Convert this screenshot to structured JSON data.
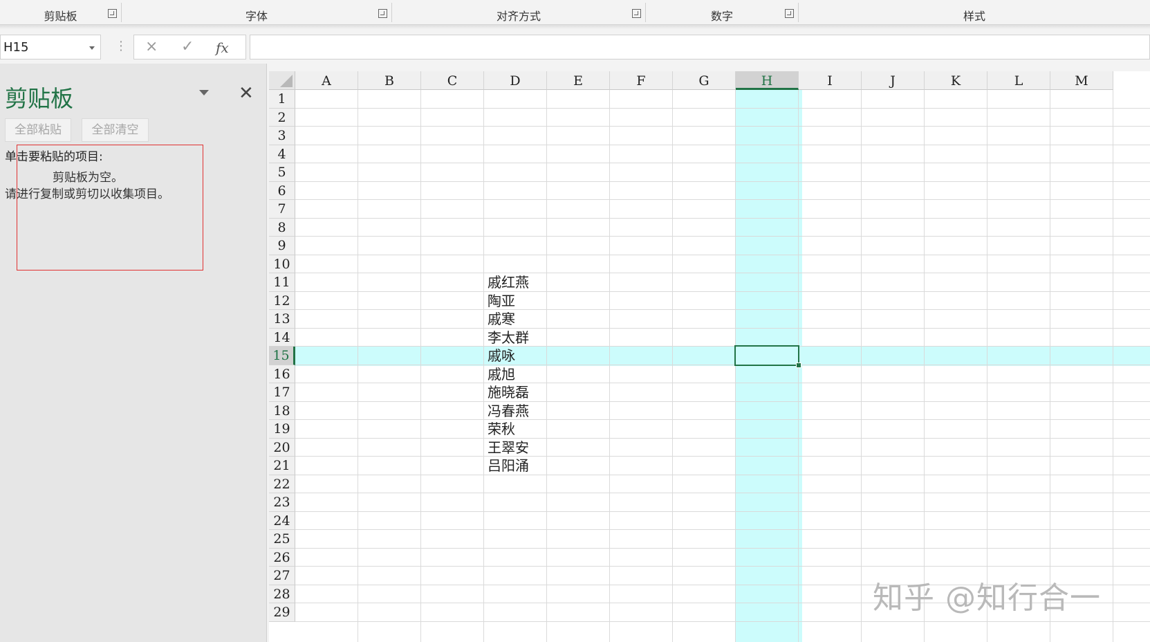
{
  "ribbon": {
    "groups": [
      {
        "label": "剪贴板",
        "launcher": true
      },
      {
        "label": "字体",
        "launcher": true
      },
      {
        "label": "对齐方式",
        "launcher": true
      },
      {
        "label": "数字",
        "launcher": true
      },
      {
        "label": "样式",
        "launcher": false
      }
    ]
  },
  "formula_bar": {
    "name_box": "H15",
    "cancel_icon": "×",
    "enter_icon": "✓",
    "fx_label": "fx",
    "formula": ""
  },
  "clipboard_pane": {
    "title": "剪贴板",
    "paste_all": "全部粘贴",
    "clear_all": "全部清空",
    "instruction": "单击要粘贴的项目:",
    "empty_line1": "剪贴板为空。",
    "empty_line2": "请进行复制或剪切以收集项目。"
  },
  "sheet": {
    "columns": [
      "A",
      "B",
      "C",
      "D",
      "E",
      "F",
      "G",
      "H",
      "I",
      "J",
      "K",
      "L",
      "M"
    ],
    "rows": [
      "1",
      "2",
      "3",
      "4",
      "5",
      "6",
      "7",
      "8",
      "9",
      "10",
      "11",
      "12",
      "13",
      "14",
      "15",
      "16",
      "17",
      "18",
      "19",
      "20",
      "21",
      "22",
      "23",
      "24",
      "25",
      "26",
      "27",
      "28",
      "29"
    ],
    "active_cell": "H15",
    "selected_column": "H",
    "selected_row": "15",
    "column_d_cells": [
      {
        "row": "11",
        "value": "戚红燕"
      },
      {
        "row": "12",
        "value": "陶亚"
      },
      {
        "row": "13",
        "value": "戚寒"
      },
      {
        "row": "14",
        "value": "李太群"
      },
      {
        "row": "15",
        "value": "戚咏"
      },
      {
        "row": "16",
        "value": "戚旭"
      },
      {
        "row": "17",
        "value": "施晓磊"
      },
      {
        "row": "18",
        "value": "冯春燕"
      },
      {
        "row": "19",
        "value": "荣秋"
      },
      {
        "row": "20",
        "value": "王翠安"
      },
      {
        "row": "21",
        "value": "吕阳涌"
      }
    ]
  },
  "watermark": "知乎 @知行合一",
  "colors": {
    "accent": "#217346",
    "highlight": "#ccfcfc",
    "annotation_box": "#e03030"
  }
}
